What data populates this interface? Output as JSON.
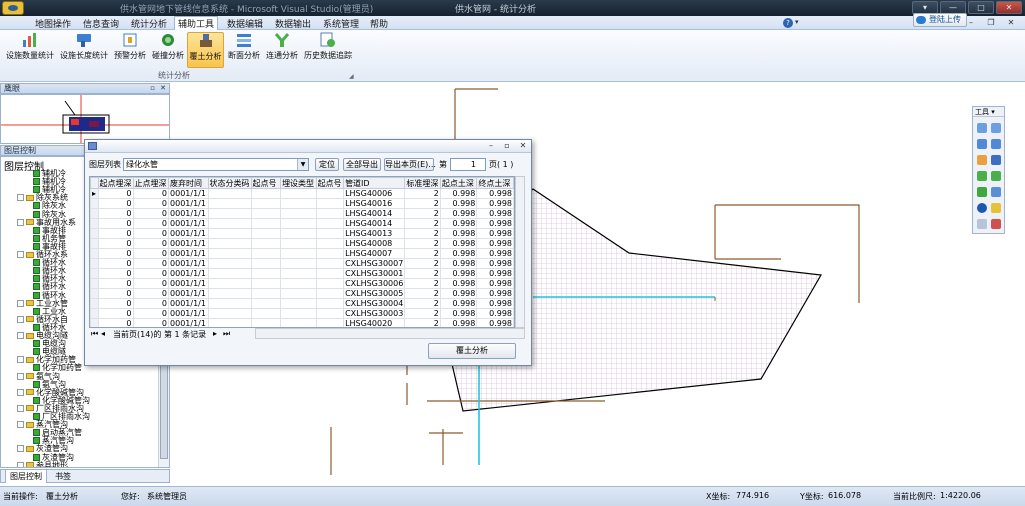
{
  "titlebar": {
    "app_title": "供水管网地下管线信息系统 - Microsoft Visual Studio(管理员)",
    "center_title": "供水管网 - 统计分析",
    "buttons": [
      "▾",
      "—",
      "□",
      "✕"
    ]
  },
  "menu": {
    "items": [
      "地图操作",
      "信息查询",
      "统计分析",
      "辅助工具",
      "数据编辑",
      "数据输出",
      "系统管理",
      "帮助"
    ],
    "active_index": 3,
    "help_icon_text": "?",
    "login_label": "登陆上传"
  },
  "ribbon": {
    "buttons": [
      {
        "label": "设施数量统计",
        "icon": "bar-chart-icon"
      },
      {
        "label": "设施长度统计",
        "icon": "ruler-icon"
      },
      {
        "label": "预警分析",
        "icon": "alarm-icon"
      },
      {
        "label": "碰撞分析",
        "icon": "collision-icon"
      },
      {
        "label": "覆土分析",
        "icon": "soil-icon"
      },
      {
        "label": "断面分析",
        "icon": "section-icon"
      },
      {
        "label": "连通分析",
        "icon": "connectivity-icon"
      },
      {
        "label": "历史数据追踪",
        "icon": "history-icon"
      }
    ],
    "active_index": 4,
    "group_label": "统计分析"
  },
  "left": {
    "eagle_title": "鹰眼",
    "layer_title": "图层控制",
    "tree_root": "图层控制",
    "tree_items": [
      {
        "text": "辅机冷",
        "indent": 2
      },
      {
        "text": "辅机冷",
        "indent": 2
      },
      {
        "text": "辅机冷",
        "indent": 2
      },
      {
        "text": "除灰系统",
        "indent": 1
      },
      {
        "text": "除灰水",
        "indent": 2
      },
      {
        "text": "除灰水",
        "indent": 2
      },
      {
        "text": "事故用水系",
        "indent": 1
      },
      {
        "text": "事故排",
        "indent": 2
      },
      {
        "text": "机务管",
        "indent": 2
      },
      {
        "text": "事故排",
        "indent": 2
      },
      {
        "text": "循环水系",
        "indent": 1
      },
      {
        "text": "循环水",
        "indent": 2
      },
      {
        "text": "循环水",
        "indent": 2
      },
      {
        "text": "循环水",
        "indent": 2
      },
      {
        "text": "循环水",
        "indent": 2
      },
      {
        "text": "循环水",
        "indent": 2
      },
      {
        "text": "工业水管",
        "indent": 1
      },
      {
        "text": "工业水",
        "indent": 2
      },
      {
        "text": "循环水自",
        "indent": 1
      },
      {
        "text": "循环水",
        "indent": 2
      },
      {
        "text": "电缆沟隧",
        "indent": 1
      },
      {
        "text": "电缆沟",
        "indent": 2
      },
      {
        "text": "电缆隧",
        "indent": 2
      },
      {
        "text": "化学加药管",
        "indent": 1
      },
      {
        "text": "化学加药管",
        "indent": 2
      },
      {
        "text": "氨气沟",
        "indent": 1
      },
      {
        "text": "氨气沟",
        "indent": 2
      },
      {
        "text": "化学酸碱管沟",
        "indent": 1
      },
      {
        "text": "化学酸碱管沟",
        "indent": 2
      },
      {
        "text": "厂区排雨水沟",
        "indent": 1
      },
      {
        "text": "厂区排雨水沟",
        "indent": 2
      },
      {
        "text": "蒸汽管沟",
        "indent": 1
      },
      {
        "text": "启动蒸汽管",
        "indent": 2
      },
      {
        "text": "蒸汽管沟",
        "indent": 2
      },
      {
        "text": "灰渣管沟",
        "indent": 1
      },
      {
        "text": "灰渣管沟",
        "indent": 2
      },
      {
        "text": "参县地形",
        "indent": 1
      }
    ],
    "tabs": [
      "图层控制",
      "书签"
    ]
  },
  "toolbox": {
    "title": "工具 ▾"
  },
  "dialog": {
    "layer_list_label": "图层列表",
    "layer_value": "绿化水管",
    "locate_btn": "定位",
    "export_all_btn": "全部导出",
    "export_page_btn": "导出本页(E)...",
    "page_prefix": "第",
    "page_value": "1",
    "page_suffix": "页( 1 )",
    "columns": [
      "起点埋深",
      "止点埋深",
      "废弃时间",
      "状态分类码",
      "起点号",
      "埋设类型",
      "起点号",
      "管道ID",
      "标准埋深",
      "起点土深",
      "终点土深"
    ],
    "rows": [
      [
        "0",
        "0",
        "0001/1/1",
        "",
        "",
        "",
        "",
        "LHSG40006",
        "2",
        "0.998",
        "0.998"
      ],
      [
        "0",
        "0",
        "0001/1/1",
        "",
        "",
        "",
        "",
        "LHSG40016",
        "2",
        "0.998",
        "0.998"
      ],
      [
        "0",
        "0",
        "0001/1/1",
        "",
        "",
        "",
        "",
        "LHSG40014",
        "2",
        "0.998",
        "0.998"
      ],
      [
        "0",
        "0",
        "0001/1/1",
        "",
        "",
        "",
        "",
        "LHSG40014",
        "2",
        "0.998",
        "0.998"
      ],
      [
        "0",
        "0",
        "0001/1/1",
        "",
        "",
        "",
        "",
        "LHSG40013",
        "2",
        "0.998",
        "0.998"
      ],
      [
        "0",
        "0",
        "0001/1/1",
        "",
        "",
        "",
        "",
        "LHSG40008",
        "2",
        "0.998",
        "0.998"
      ],
      [
        "0",
        "0",
        "0001/1/1",
        "",
        "",
        "",
        "",
        "LHSG40007",
        "2",
        "0.998",
        "0.998"
      ],
      [
        "0",
        "0",
        "0001/1/1",
        "",
        "",
        "",
        "",
        "CXLHSG30007",
        "2",
        "0.998",
        "0.998"
      ],
      [
        "0",
        "0",
        "0001/1/1",
        "",
        "",
        "",
        "",
        "CXLHSG30001",
        "2",
        "0.998",
        "0.998"
      ],
      [
        "0",
        "0",
        "0001/1/1",
        "",
        "",
        "",
        "",
        "CXLHSG30006",
        "2",
        "0.998",
        "0.998"
      ],
      [
        "0",
        "0",
        "0001/1/1",
        "",
        "",
        "",
        "",
        "CXLHSG30005",
        "2",
        "0.998",
        "0.998"
      ],
      [
        "0",
        "0",
        "0001/1/1",
        "",
        "",
        "",
        "",
        "CXLHSG30004",
        "2",
        "0.998",
        "0.998"
      ],
      [
        "0",
        "0",
        "0001/1/1",
        "",
        "",
        "",
        "",
        "CXLHSG30003",
        "2",
        "0.998",
        "0.998"
      ],
      [
        "0",
        "0",
        "0001/1/1",
        "",
        "",
        "",
        "",
        "LHSG40020",
        "2",
        "0.998",
        "0.998"
      ]
    ],
    "record_nav": "当前页(14)的 第 1 条记录",
    "analyze_btn": "覆土分析"
  },
  "status": {
    "op_label": "当前操作:",
    "op_value": "覆土分析",
    "user_label": "您好:",
    "user_value": "系统管理员",
    "x_label": "X坐标:",
    "x_value": "774.916",
    "y_label": "Y坐标:",
    "y_value": "616.078",
    "scale_label": "当前比例尺:",
    "scale_value": "1:4220.06"
  },
  "colors": {
    "pipe_brown": "#8b5a2b",
    "pipe_cyan": "#22c4e0",
    "hatch": "#c9a6d6",
    "polygon_edge": "#000000"
  }
}
